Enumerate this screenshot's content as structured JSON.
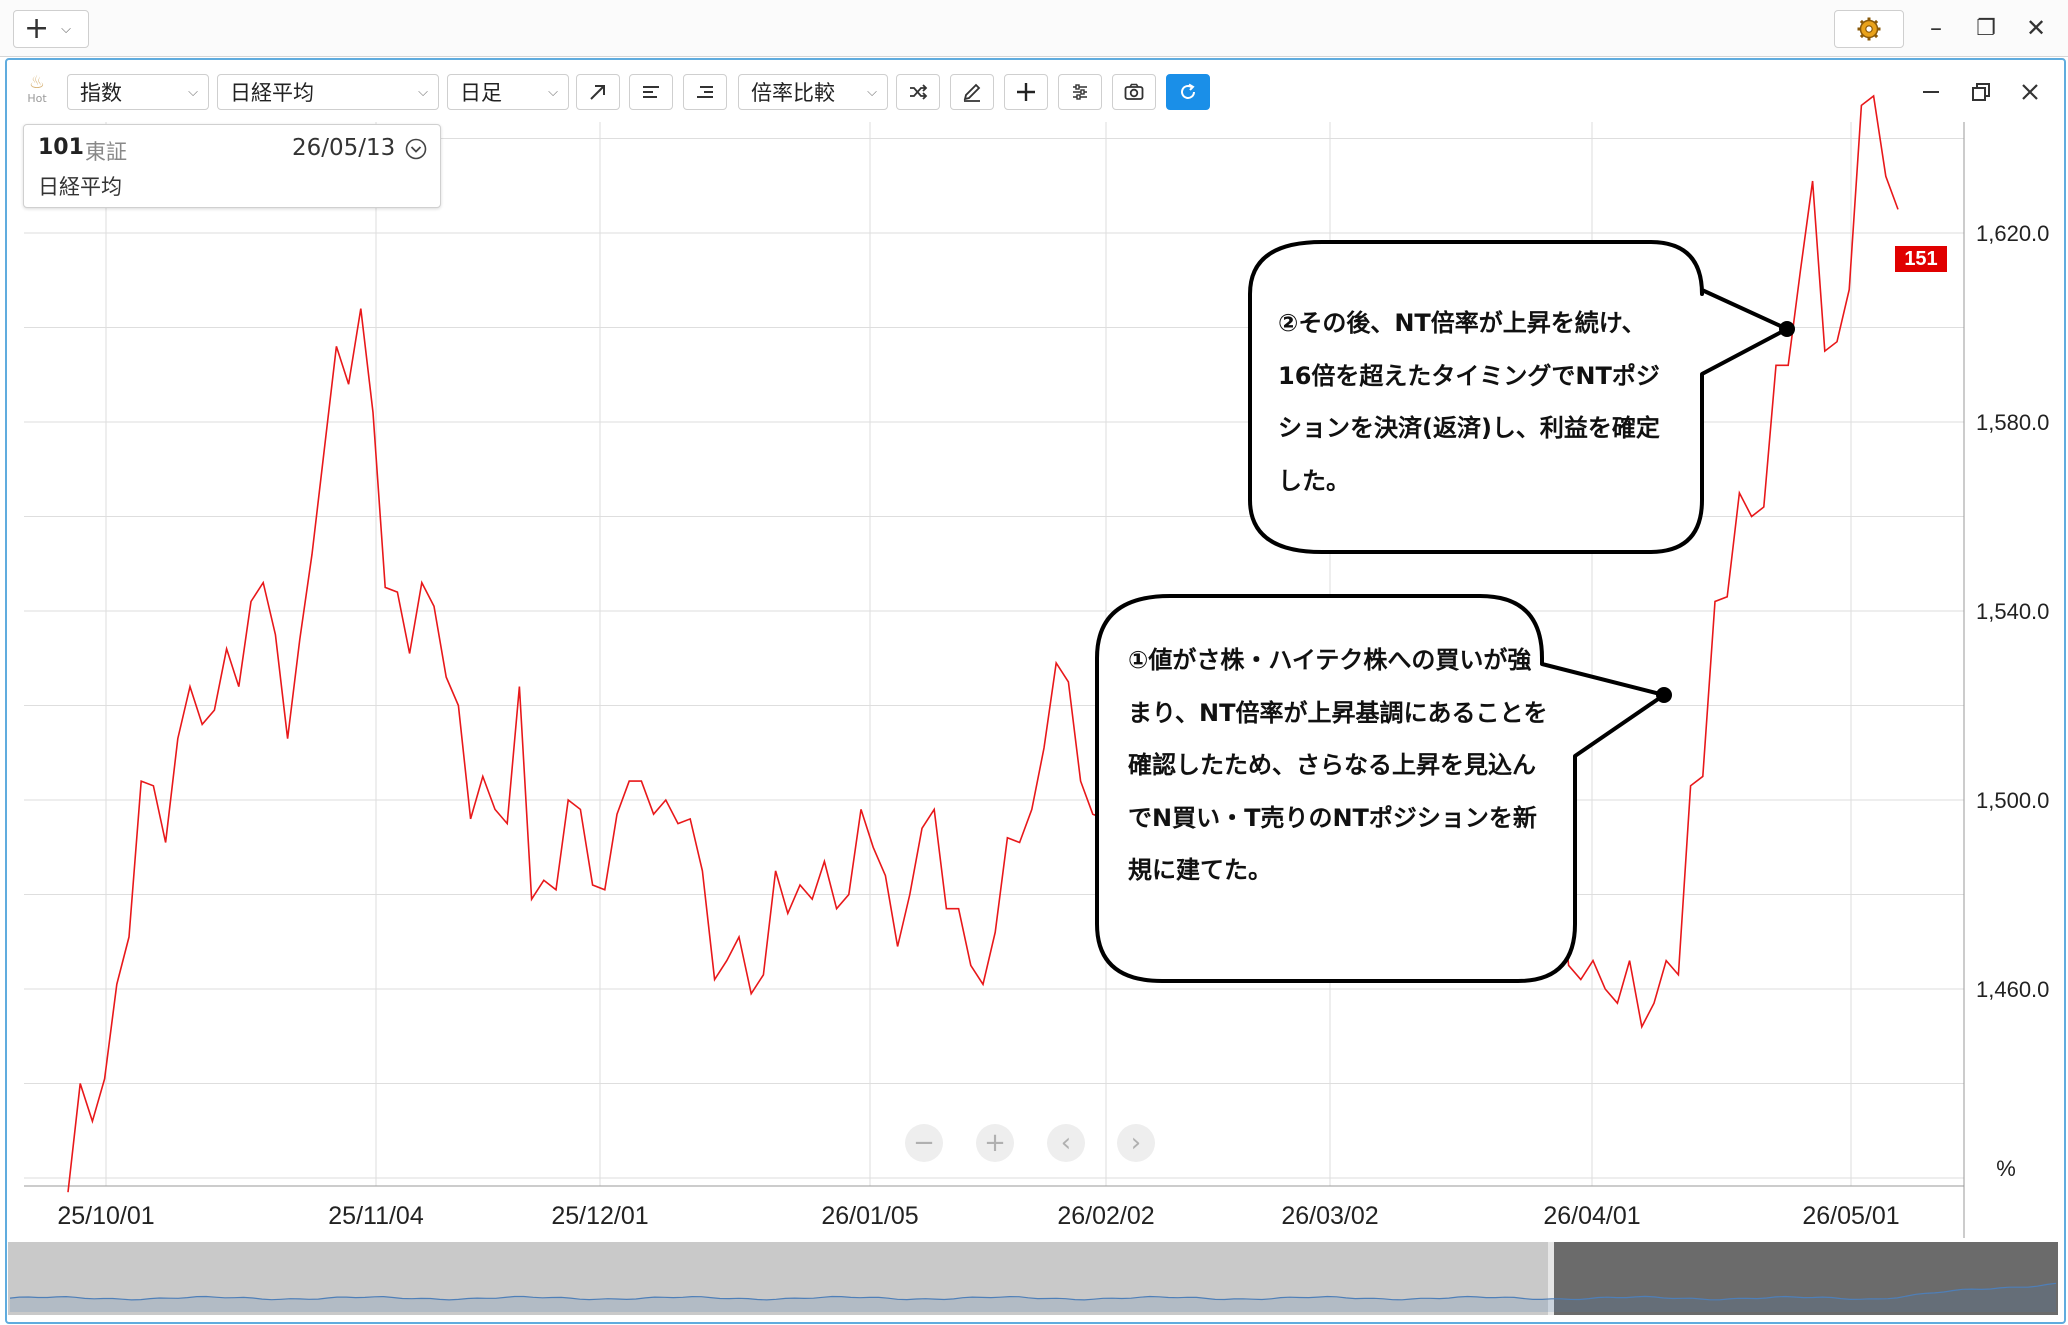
{
  "window": {
    "add_label": "+",
    "minimize_label": "–",
    "restore_label": "❐",
    "close_label": "✕"
  },
  "toolbar": {
    "hot_label": "Hot",
    "category_select": "指数",
    "symbol_select": "日経平均",
    "period_select": "日足",
    "compare_select": "倍率比較"
  },
  "infobox": {
    "code": "101",
    "exchange": "東証",
    "date": "26/05/13",
    "name": "日経平均"
  },
  "chart_data": {
    "type": "line",
    "color": "#e8181a",
    "unit_label": "%",
    "last_value_badge": "151",
    "y_ticks": [
      "1,620.0",
      "1,580.0",
      "1,540.0",
      "1,500.0",
      "1,460.0"
    ],
    "y_tick_values": [
      1620,
      1580,
      1540,
      1500,
      1460
    ],
    "ylim": [
      1410,
      1650
    ],
    "x_ticks": [
      "25/10/01",
      "25/11/04",
      "25/12/01",
      "26/01/05",
      "26/02/02",
      "26/03/02",
      "26/04/01",
      "26/05/01"
    ],
    "grid": true,
    "series": [
      {
        "values": [
          1417,
          1440,
          1432,
          1441,
          1461,
          1471,
          1504,
          1503,
          1491,
          1513,
          1524,
          1516,
          1519,
          1532,
          1524,
          1542,
          1546,
          1535,
          1513,
          1534,
          1552,
          1574,
          1596,
          1588,
          1604,
          1582,
          1545,
          1544,
          1531,
          1546,
          1541,
          1526,
          1520,
          1496,
          1505,
          1498,
          1495,
          1524,
          1479,
          1483,
          1481,
          1500,
          1498,
          1482,
          1481,
          1497,
          1504,
          1504,
          1497,
          1500,
          1495,
          1496,
          1485,
          1462,
          1466,
          1471,
          1459,
          1463,
          1485,
          1476,
          1482,
          1479,
          1487,
          1477,
          1480,
          1498,
          1490,
          1484,
          1469,
          1480,
          1494,
          1498,
          1477,
          1477,
          1465,
          1461,
          1472,
          1492,
          1491,
          1498,
          1511,
          1529,
          1525,
          1504,
          1497,
          1496,
          1495,
          1494,
          1494,
          1494,
          1494,
          1494,
          1494,
          1494,
          1494,
          1494,
          1494,
          1494,
          1494,
          1494,
          1494,
          1494,
          1494,
          1494,
          1494,
          1494,
          1494,
          1494,
          1494,
          1494,
          1494,
          1494,
          1494,
          1494,
          1494,
          1494,
          1494,
          1494,
          1494,
          1494,
          1494,
          1494,
          1494,
          1465,
          1462,
          1466,
          1460,
          1457,
          1466,
          1452,
          1457,
          1466,
          1463,
          1503,
          1505,
          1542,
          1543,
          1565,
          1560,
          1562,
          1592,
          1592,
          1612,
          1631,
          1595,
          1597,
          1608,
          1647,
          1649,
          1632,
          1625
        ]
      }
    ]
  },
  "callouts": [
    {
      "text": "②その後、NT倍率が上昇を続け、16倍を超えたタイミングでNTポジションを決済(返済)し、利益を確定した。"
    },
    {
      "text": "①値がさ株・ハイテク株への買いが強まり、NT倍率が上昇基調にあることを確認したため、さらなる上昇を見込んでN買い・T売りのNTポジションを新規に建てた。"
    }
  ],
  "navigation": {
    "zoom_out": "−",
    "zoom_in": "+",
    "prev": "‹",
    "next": "›"
  }
}
